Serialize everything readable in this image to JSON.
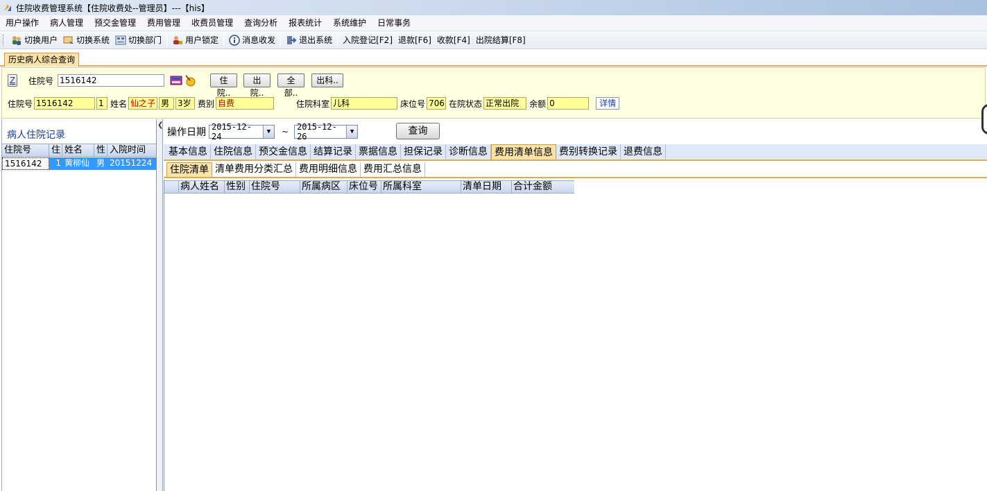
{
  "window": {
    "title": "住院收费管理系统【住院收费处--管理员】---【his】"
  },
  "menu": [
    "用户操作",
    "病人管理",
    "预交金管理",
    "费用管理",
    "收费员管理",
    "查询分析",
    "报表统计",
    "系统维护",
    "日常事务"
  ],
  "toolbar": {
    "switch_user": "切换用户",
    "switch_system": "切换系统",
    "switch_dept": "切换部门",
    "lock_user": "用户锁定",
    "messages": "消息收发",
    "exit": "退出系统",
    "admit": "入院登记[F2]",
    "refund": "退款[F6]",
    "collect": "收款[F4]",
    "discharge_settle": "出院结算[F8]"
  },
  "outer_tab": "历史病人综合查询",
  "search": {
    "z_label": "Z",
    "inpatient_no_label": "住院号",
    "inpatient_no_value": "1516142",
    "btn_admitted": "住院",
    "btn_discharged": "出院",
    "btn_all": "全部",
    "btn_out_dept": "出科",
    "btn_suffix": ".."
  },
  "patient": {
    "inpatient_no_label": "住院号",
    "inpatient_no": "1516142",
    "visit_count": "1",
    "name_label": "姓名",
    "name": "仙之子",
    "sex": "男",
    "age": "3岁",
    "fee_type_label": "费别",
    "fee_type": "自费",
    "dept_label": "住院科室",
    "dept": "儿科",
    "bed_label": "床位号",
    "bed": "706",
    "status_label": "在院状态",
    "status": "正常出院",
    "balance_label": "余额",
    "balance": "0",
    "details": "详情"
  },
  "left": {
    "title": "病人住院记录",
    "columns": [
      "住院号",
      "住",
      "姓名",
      "性",
      "入院时间"
    ],
    "rows": [
      [
        "1516142",
        "1",
        "黄柳仙",
        "男",
        "20151224"
      ]
    ]
  },
  "query": {
    "date_label": "操作日期",
    "date_from": "2015-12-24",
    "tilde": "~",
    "date_to": "2015-12-26",
    "button": "查询"
  },
  "tabs1": [
    "基本信息",
    "住院信息",
    "预交金信息",
    "结算记录",
    "票据信息",
    "担保记录",
    "诊断信息",
    "费用清单信息",
    "费别转换记录",
    "退费信息"
  ],
  "tabs1_active": 7,
  "tabs2": [
    "住院清单",
    "清单费用分类汇总",
    "费用明细信息",
    "费用汇总信息"
  ],
  "tabs2_active": 0,
  "grid_columns": [
    "",
    "病人姓名",
    "性别",
    "住院号",
    "所属病区",
    "床位号",
    "所属科室",
    "清单日期",
    "合计金额"
  ]
}
